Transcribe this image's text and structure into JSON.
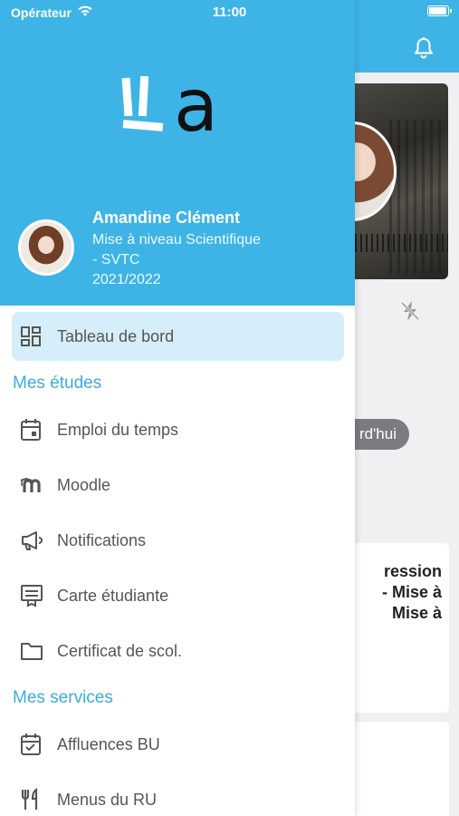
{
  "status_bar": {
    "carrier": "Opérateur",
    "time": "11:00",
    "battery_level": 1.0
  },
  "profile": {
    "name": "Amandine Clément",
    "program": "Mise à niveau Scientifique",
    "program_line2": "- SVTC",
    "year": "2021/2022"
  },
  "menu": {
    "dashboard": {
      "label": "Tableau de bord",
      "icon": "dashboard-icon"
    },
    "section_studies": "Mes études",
    "studies": [
      {
        "label": "Emploi du temps",
        "icon": "calendar-icon"
      },
      {
        "label": "Moodle",
        "icon": "moodle-icon"
      },
      {
        "label": "Notifications",
        "icon": "megaphone-icon"
      },
      {
        "label": "Carte étudiante",
        "icon": "student-card-icon"
      },
      {
        "label": "Certificat de scol.",
        "icon": "folder-icon"
      }
    ],
    "section_services": "Mes services",
    "services": [
      {
        "label": "Affluences BU",
        "icon": "calendar-check-icon"
      },
      {
        "label": "Menus du RU",
        "icon": "fork-knife-icon"
      }
    ]
  },
  "background": {
    "today_pill": "rd'hui",
    "card_text": "ression\n- Mise à\nMise à"
  },
  "colors": {
    "brand_blue": "#3db4e5",
    "active_bg": "#d5eef9",
    "section_title": "#3aaedb",
    "item_text": "#555555"
  }
}
